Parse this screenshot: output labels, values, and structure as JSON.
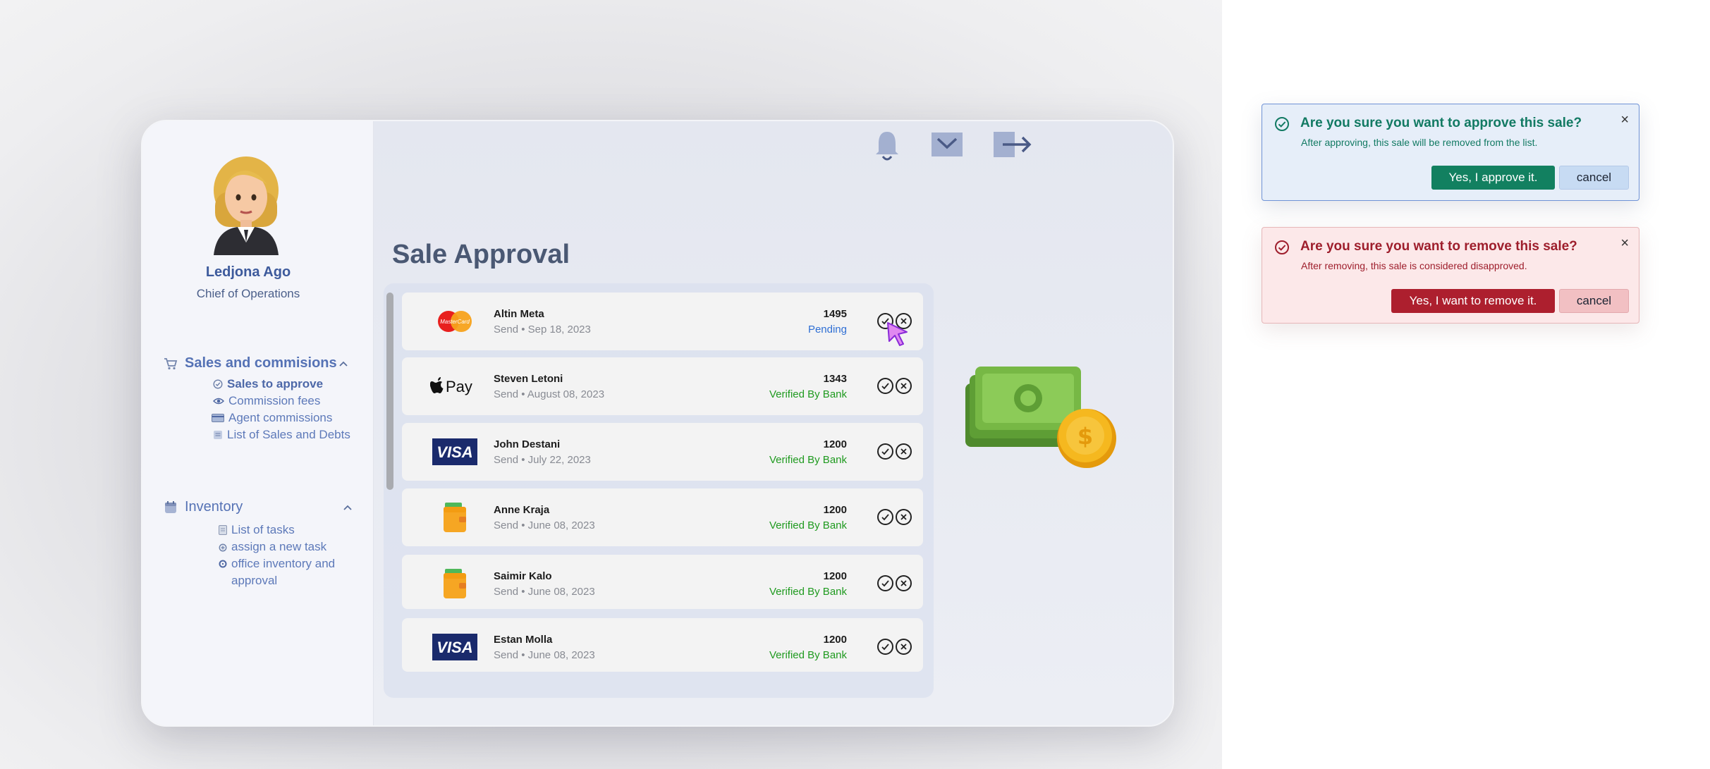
{
  "profile": {
    "name": "Ledjona Ago",
    "role": "Chief of Operations"
  },
  "sidebar": {
    "sales": {
      "title": "Sales and commisions",
      "items": [
        {
          "label": "Sales to approve",
          "icon": "check-circle-icon"
        },
        {
          "label": "Commission fees",
          "icon": "eye-icon"
        },
        {
          "label": "Agent commissions",
          "icon": "card-icon"
        },
        {
          "label": "List of Sales and Debts",
          "icon": "list-icon"
        }
      ]
    },
    "inventory": {
      "title": "Inventory",
      "items": [
        {
          "label": "List of tasks",
          "icon": "document-icon"
        },
        {
          "label": "assign a new task",
          "icon": "add-icon"
        },
        {
          "label": "office inventory and",
          "label2": "approval",
          "icon": "gear-icon"
        }
      ]
    }
  },
  "header": {
    "icons": [
      "bell-icon",
      "mail-icon",
      "logout-icon"
    ]
  },
  "main": {
    "title": "Sale Approval",
    "rows": [
      {
        "name": "Altin Meta",
        "sub": "Send • Sep 18, 2023",
        "amount": "1495",
        "status": "Pending",
        "logo": "mastercard"
      },
      {
        "name": "Steven Letoni",
        "sub": "Send • August 08, 2023",
        "amount": "1343",
        "status": "Verified By Bank",
        "logo": "applepay"
      },
      {
        "name": "John Destani",
        "sub": "Send • July 22, 2023",
        "amount": "1200",
        "status": "Verified By Bank",
        "logo": "visa"
      },
      {
        "name": "Anne Kraja",
        "sub": "Send • June 08, 2023",
        "amount": "1200",
        "status": "Verified By Bank",
        "logo": "wallet"
      },
      {
        "name": "Saimir Kalo",
        "sub": "Send • June 08, 2023",
        "amount": "1200",
        "status": "Verified By Bank",
        "logo": "wallet"
      },
      {
        "name": "Estan Molla",
        "sub": "Send • June 08, 2023",
        "amount": "1200",
        "status": "Verified By Bank",
        "logo": "visa"
      }
    ]
  },
  "logos": {
    "mastercard_text": "MasterCard",
    "applepay_text": "Pay",
    "visa_text": "VISA"
  },
  "dialogs": {
    "approve": {
      "title": "Are you sure you want to approve this sale?",
      "text": "After approving, this sale will be removed from the list.",
      "confirm": "Yes, I approve it.",
      "cancel": "cancel",
      "close": "×"
    },
    "remove": {
      "title": "Are you sure you want to remove this sale?",
      "text": "After removing, this sale is considered disapproved.",
      "confirm": "Yes, I want to remove it.",
      "cancel": "cancel",
      "close": "×"
    }
  },
  "colors": {
    "accent": "#5572b5",
    "pending": "#2f6fd4",
    "verified": "#1f9a1f",
    "approve": "#128060",
    "remove": "#ad1f2e"
  }
}
